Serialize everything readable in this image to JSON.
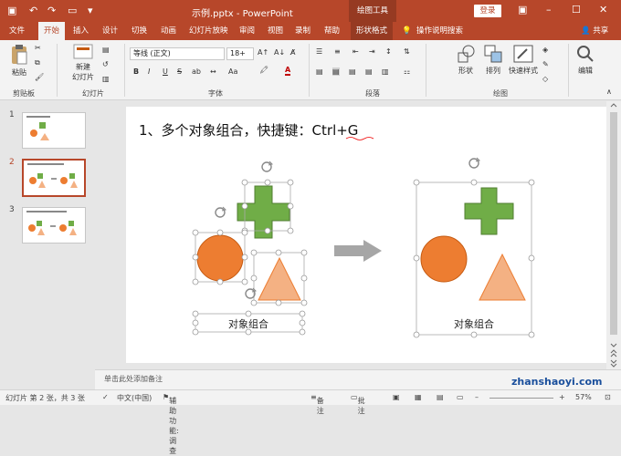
{
  "titlebar": {
    "title": "示例.pptx - PowerPoint",
    "context_group": "绘图工具",
    "login": "登录"
  },
  "tabs": [
    {
      "label": "文件"
    },
    {
      "label": "开始"
    },
    {
      "label": "插入"
    },
    {
      "label": "设计"
    },
    {
      "label": "切换"
    },
    {
      "label": "动画"
    },
    {
      "label": "幻灯片放映"
    },
    {
      "label": "审阅"
    },
    {
      "label": "视图"
    },
    {
      "label": "录制"
    },
    {
      "label": "帮助"
    },
    {
      "label": "形状格式"
    },
    {
      "label": "操作说明搜索"
    }
  ],
  "share": "共享",
  "ribbon": {
    "paste": "粘贴",
    "new_slide_1": "新建",
    "new_slide_2": "幻灯片",
    "font_name": "等线 (正文)",
    "font_size": "18+",
    "bold": "B",
    "italic": "I",
    "underline": "U",
    "strike": "S",
    "shadow": "ab",
    "font_color": "A",
    "shape": "形状",
    "arrange": "排列",
    "quick_styles": "快速样式",
    "edit": "编辑",
    "groups": {
      "clipboard": "剪贴板",
      "slides": "幻灯片",
      "font": "字体",
      "paragraph": "段落",
      "drawing": "绘图"
    }
  },
  "thumbs": [
    {
      "num": "1"
    },
    {
      "num": "2"
    },
    {
      "num": "3"
    }
  ],
  "slide": {
    "title": "1、多个对象组合，快捷键：Ctrl+G",
    "left_label": "对象组合",
    "right_label": "对象组合"
  },
  "notes_placeholder": "单击此处添加备注",
  "status": {
    "slide_info": "幻灯片 第 2 张，共 3 张",
    "language": "中文(中国)",
    "accessibility": "辅助功能: 调查",
    "notes": "备注",
    "comments": "批注",
    "zoom": "57%"
  },
  "watermark": "zhanshaoyi.com",
  "colors": {
    "accent": "#b7472a",
    "orange": "#ed7d31",
    "green": "#70ad47",
    "salmon": "#f4b183",
    "arrow": "#a6a6a6"
  }
}
